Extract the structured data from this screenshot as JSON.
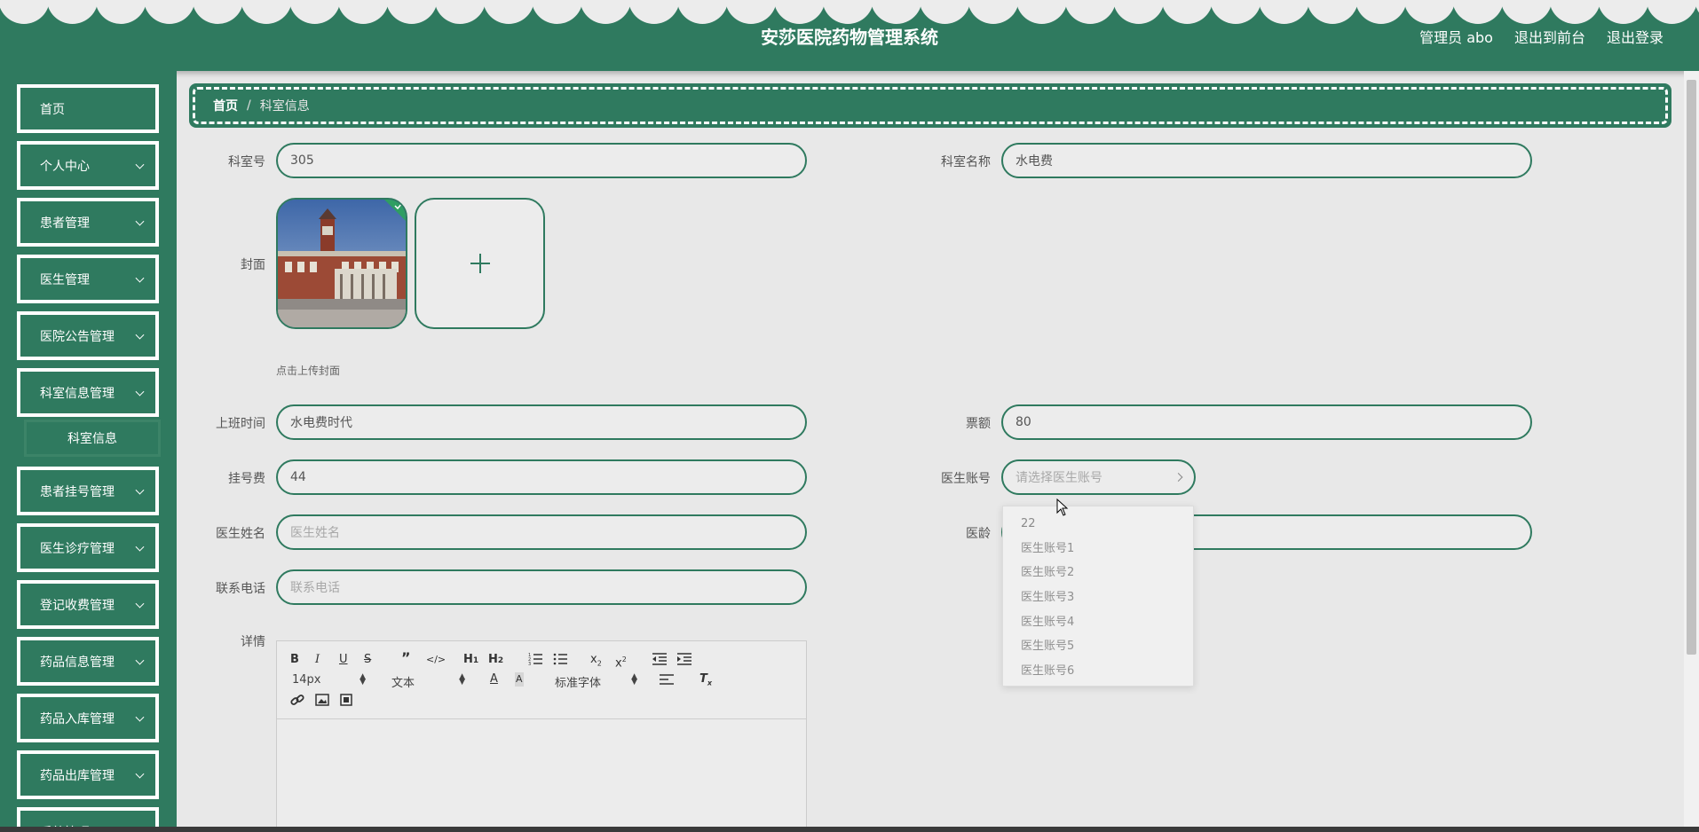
{
  "header": {
    "title": "安莎医院药物管理系统",
    "admin_label": "管理员 abo",
    "back_label": "退出到前台",
    "logout_label": "退出登录"
  },
  "sidebar": {
    "items": [
      {
        "label": "首页",
        "has_arrow": false
      },
      {
        "label": "个人中心",
        "has_arrow": true
      },
      {
        "label": "患者管理",
        "has_arrow": true
      },
      {
        "label": "医生管理",
        "has_arrow": true
      },
      {
        "label": "医院公告管理",
        "has_arrow": true
      },
      {
        "label": "科室信息管理",
        "has_arrow": true
      },
      {
        "label": "患者挂号管理",
        "has_arrow": true
      },
      {
        "label": "医生诊疗管理",
        "has_arrow": true
      },
      {
        "label": "登记收费管理",
        "has_arrow": true
      },
      {
        "label": "药品信息管理",
        "has_arrow": true
      },
      {
        "label": "药品入库管理",
        "has_arrow": true
      },
      {
        "label": "药品出库管理",
        "has_arrow": true
      },
      {
        "label": "系统管理",
        "has_arrow": true
      }
    ],
    "submenu_label": "科室信息"
  },
  "breadcrumb": {
    "home": "首页",
    "separator": "/",
    "current": "科室信息"
  },
  "form": {
    "room_no": {
      "label": "科室号",
      "value": "305"
    },
    "room_name": {
      "label": "科室名称",
      "value": "水电费"
    },
    "cover": {
      "label": "封面",
      "tip": "点击上传封面"
    },
    "work_time": {
      "label": "上班时间",
      "value": "水电费时代"
    },
    "ticket": {
      "label": "票额",
      "value": "80"
    },
    "fee": {
      "label": "挂号费",
      "value": "44"
    },
    "doctor_account": {
      "label": "医生账号",
      "placeholder": "请选择医生账号"
    },
    "doctor_name": {
      "label": "医生姓名",
      "placeholder": "医生姓名"
    },
    "doctor_age": {
      "label": "医龄",
      "value": "22"
    },
    "phone": {
      "label": "联系电话",
      "placeholder": "联系电话"
    },
    "detail": {
      "label": "详情"
    }
  },
  "dropdown": {
    "options": [
      "医生账号1",
      "医生账号2",
      "医生账号3",
      "医生账号4",
      "医生账号5",
      "医生账号6"
    ]
  },
  "editor": {
    "font_size": "14px",
    "header_picker": "文本",
    "font_picker": "标准字体"
  },
  "colors": {
    "primary": "#2f7a5f",
    "background": "#e8e8e8",
    "text": "#555555"
  }
}
